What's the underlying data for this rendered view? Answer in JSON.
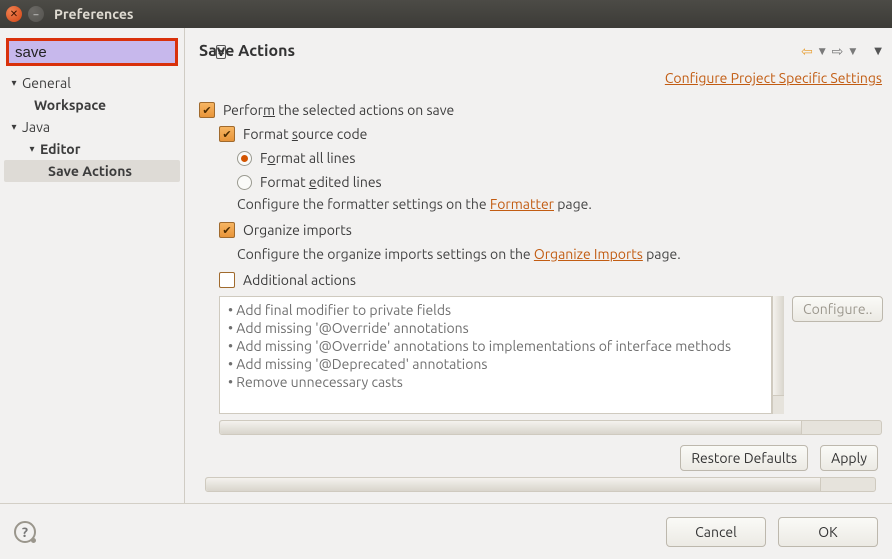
{
  "window": {
    "title": "Preferences"
  },
  "search": {
    "value": "save"
  },
  "tree": {
    "general": "General",
    "workspace": "Workspace",
    "java": "Java",
    "editor": "Editor",
    "save_actions": "Save Actions"
  },
  "page": {
    "title": "Save Actions",
    "project_link": "Configure Project Specific Settings"
  },
  "opts": {
    "perform_pre": "Perfor",
    "perform_m": "m",
    "perform_post": " the selected actions on save",
    "format_pre": "Format ",
    "format_s": "s",
    "format_post": "ource code",
    "all_pre": "F",
    "all_o": "o",
    "all_post": "rmat all lines",
    "edited_pre": "Format ",
    "edited_e": "e",
    "edited_post": "dited lines",
    "formatter_help_pre": "Configure the formatter settings on the ",
    "formatter_link": "Formatter",
    "formatter_help_post": " page.",
    "organize_pre": "Or",
    "organize_g": "g",
    "organize_post": "anize imports",
    "organize_help_pre": "Configure the organize imports settings on the ",
    "organize_link": "Organize Imports",
    "organize_help_post": " page.",
    "addl": "Additional actions"
  },
  "addl_list": {
    "a0": "Add final modifier to private fields",
    "a1": "Add missing '@Override' annotations",
    "a2": "Add missing '@Override' annotations to implementations of interface methods",
    "a3": "Add missing '@Deprecated' annotations",
    "a4": "Remove unnecessary casts"
  },
  "buttons": {
    "configure": "Configure..",
    "restore": "Restore Defaults",
    "apply": "Apply",
    "cancel": "Cancel",
    "ok": "OK"
  }
}
